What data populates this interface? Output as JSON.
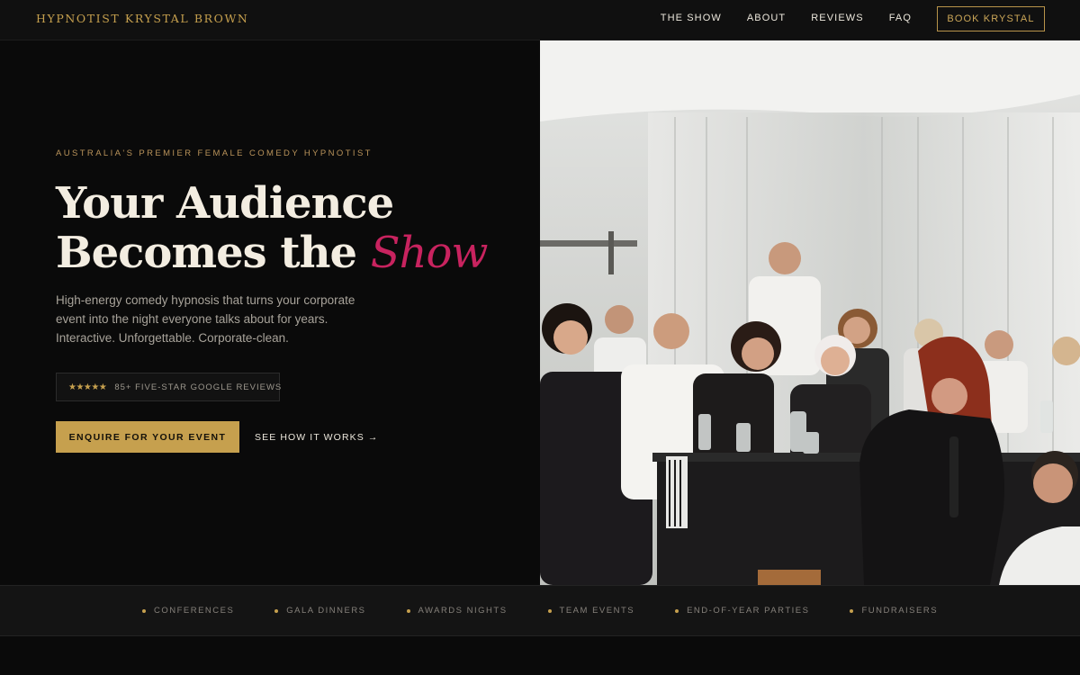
{
  "header": {
    "brand": "HYPNOTIST KRYSTAL BROWN",
    "nav": [
      "THE SHOW",
      "ABOUT",
      "REVIEWS",
      "FAQ"
    ],
    "cta": "BOOK KRYSTAL"
  },
  "hero": {
    "eyebrow": "AUSTRALIA'S PREMIER FEMALE COMEDY HYPNOTIST",
    "headline_line1": "Your Audience",
    "headline_line2_prefix": "Becomes the ",
    "headline_accent": "Show",
    "subtext": "High-energy comedy hypnosis that turns your corporate event into the night everyone talks about for years. Interactive. Unforgettable. Corporate-clean.",
    "stars": "★★★★★",
    "reviews": "85+ FIVE-STAR GOOGLE REVIEWS",
    "primary_cta": "ENQUIRE FOR YOUR EVENT",
    "secondary_cta": "SEE HOW IT WORKS →"
  },
  "events": [
    "CONFERENCES",
    "GALA DINNERS",
    "AWARDS NIGHTS",
    "TEAM EVENTS",
    "END-OF-YEAR PARTIES",
    "FUNDRAISERS"
  ],
  "colors": {
    "gold": "#c6a04e",
    "accent_pink": "#c8235f",
    "background": "#0a0a0a"
  }
}
